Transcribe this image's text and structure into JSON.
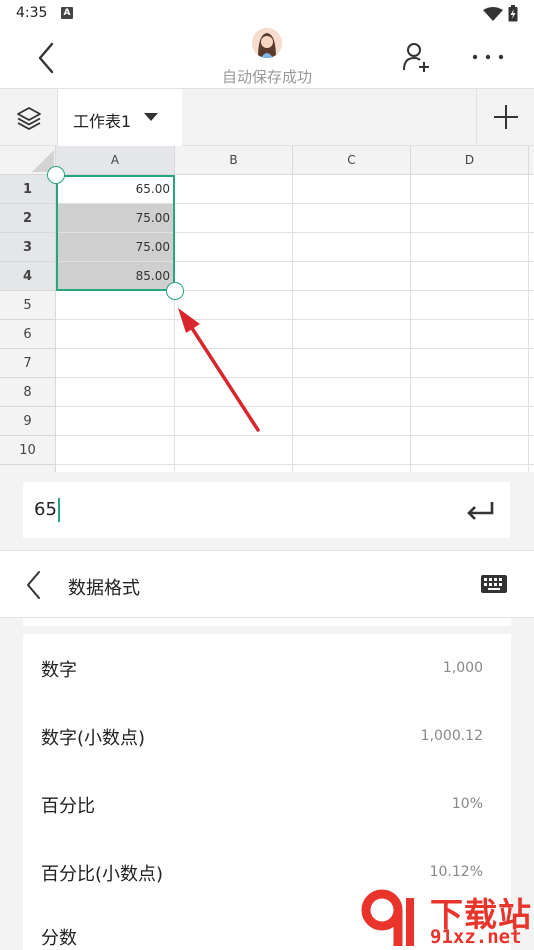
{
  "status_bar": {
    "time": "4:35",
    "notification_badge": "A"
  },
  "header": {
    "autosave_text": "自动保存成功"
  },
  "sheet_tabs": {
    "active_sheet": "工作表1"
  },
  "grid": {
    "columns": [
      "A",
      "B",
      "C",
      "D"
    ],
    "rows": [
      "1",
      "2",
      "3",
      "4",
      "5",
      "6",
      "7",
      "8",
      "9",
      "10"
    ],
    "column_a_values": [
      "65.00",
      "75.00",
      "75.00",
      "85.00"
    ]
  },
  "formula_bar": {
    "value": "65"
  },
  "data_format_panel": {
    "title": "数据格式",
    "options": [
      {
        "label": "数字",
        "example": "1,000"
      },
      {
        "label": "数字(小数点)",
        "example": "1,000.12"
      },
      {
        "label": "百分比",
        "example": "10%"
      },
      {
        "label": "百分比(小数点)",
        "example": "10.12%"
      },
      {
        "label": "分数",
        "example": ""
      }
    ]
  },
  "watermark": {
    "brand": "下载站",
    "domain": "91xz.net"
  },
  "colors": {
    "selection": "#27a57f",
    "annotation_arrow": "#d9262c",
    "watermark": "#e8342a"
  }
}
